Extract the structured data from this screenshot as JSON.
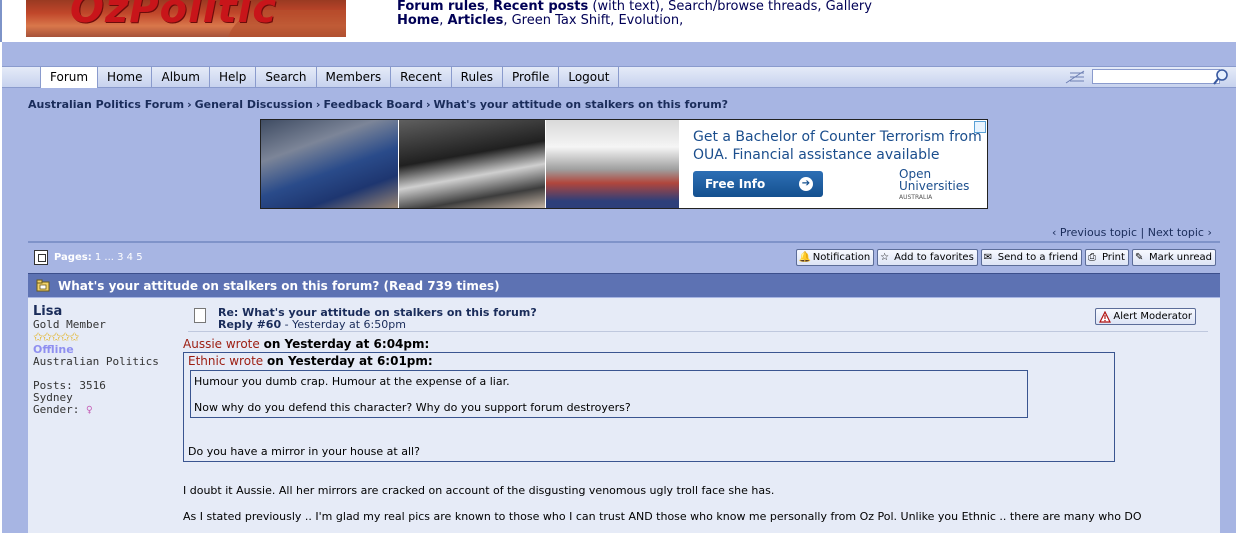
{
  "header": {
    "logo_text": "OzPolitic",
    "links_row1": [
      {
        "label": "Forum rules",
        "bold": true,
        "sep": ", "
      },
      {
        "label": "Recent posts",
        "bold": true,
        "sep": " "
      },
      {
        "label": "(with text), Search/browse threads, Gallery",
        "bold": false,
        "sep": ""
      }
    ],
    "links_row2": [
      {
        "label": "Home",
        "bold": true,
        "sep": ", "
      },
      {
        "label": "Articles",
        "bold": true,
        "sep": ", "
      },
      {
        "label": "Green Tax Shift, Evolution,",
        "bold": false,
        "sep": ""
      }
    ]
  },
  "nav": {
    "tabs": [
      "Forum",
      "Home",
      "Album",
      "Help",
      "Search",
      "Members",
      "Recent",
      "Rules",
      "Profile",
      "Logout"
    ],
    "active": "Forum",
    "search_value": ""
  },
  "breadcrumb": [
    "Australian Politics Forum",
    "General Discussion",
    "Feedback Board",
    "What's your attitude on stalkers on this forum?"
  ],
  "ad": {
    "line1": "Get a Bachelor of Counter Terrorism from",
    "line2": "OUA. Financial assistance available",
    "cta": "Free Info",
    "logo_line1": "Open",
    "logo_line2": "Universities",
    "logo_sub": "AUSTRALIA"
  },
  "topic_nav": {
    "prev": "‹ Previous topic",
    "sep": " | ",
    "next": "Next topic ›"
  },
  "pagebar": {
    "label": "Pages:",
    "pages": " 1 ... 3 4 5",
    "buttons": [
      "Notification",
      "Add to favorites",
      "Send to a friend",
      "Print",
      "Mark unread"
    ]
  },
  "topic_title": "What's your attitude on stalkers on this forum? (Read 739 times)",
  "post": {
    "poster": {
      "name": "Lisa",
      "rank": "Gold Member",
      "stars": "✩✩✩✩✩",
      "status": "Offline",
      "tagline": "Australian Politics",
      "posts": "Posts: 3516",
      "location": "Sydney",
      "gender_label": "Gender:",
      "gender_symbol": "♀"
    },
    "subject": "Re: What's your attitude on stalkers on this forum?",
    "reply_no": "Reply #60",
    "reply_time": " - Yesterday at 6:50pm",
    "alert_label": "Alert Moderator",
    "quote1_author": "Aussie wrote",
    "quote1_time": "on Yesterday at 6:04pm:",
    "quote2_author": "Ethnic wrote",
    "quote2_time": "on Yesterday at 6:01pm:",
    "quote2_line1": "Humour you dumb crap. Humour at the expense of a liar.",
    "quote2_line2": "Now why do you defend this character? Why do you support forum destroyers?",
    "quote1_text": "Do you have a mirror in your house at all?",
    "reply_text1": "I doubt it Aussie. All her mirrors are cracked on account of the disgusting venomous ugly troll face she has.",
    "reply_text2": "As I stated previously ..  I'm glad my real pics are known to those who I can trust AND those who know me personally from Oz Pol. Unlike you Ethnic .. there are many who DO"
  }
}
